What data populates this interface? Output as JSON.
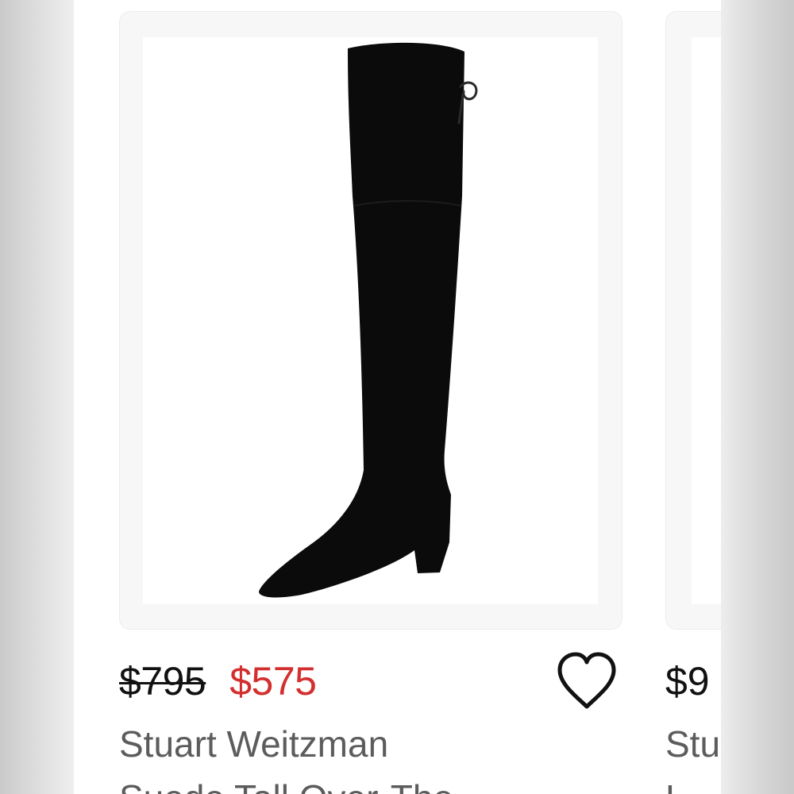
{
  "listing_main": {
    "image_alt": "Black suede over-the-knee boot",
    "price_original": "$795",
    "price_sale": "$575",
    "title_line1": "Stuart Weitzman",
    "title_line2": "Suede Tall Over-The",
    "like_icon": "heart-outline-icon"
  },
  "listing_next": {
    "price_current": "$9",
    "title_line1": "Stu",
    "title_line2": "L"
  },
  "colors": {
    "sale_price": "#d32f2f",
    "original_price": "#111111",
    "title_text": "#5c5c5c",
    "card_border": "#ececec"
  }
}
